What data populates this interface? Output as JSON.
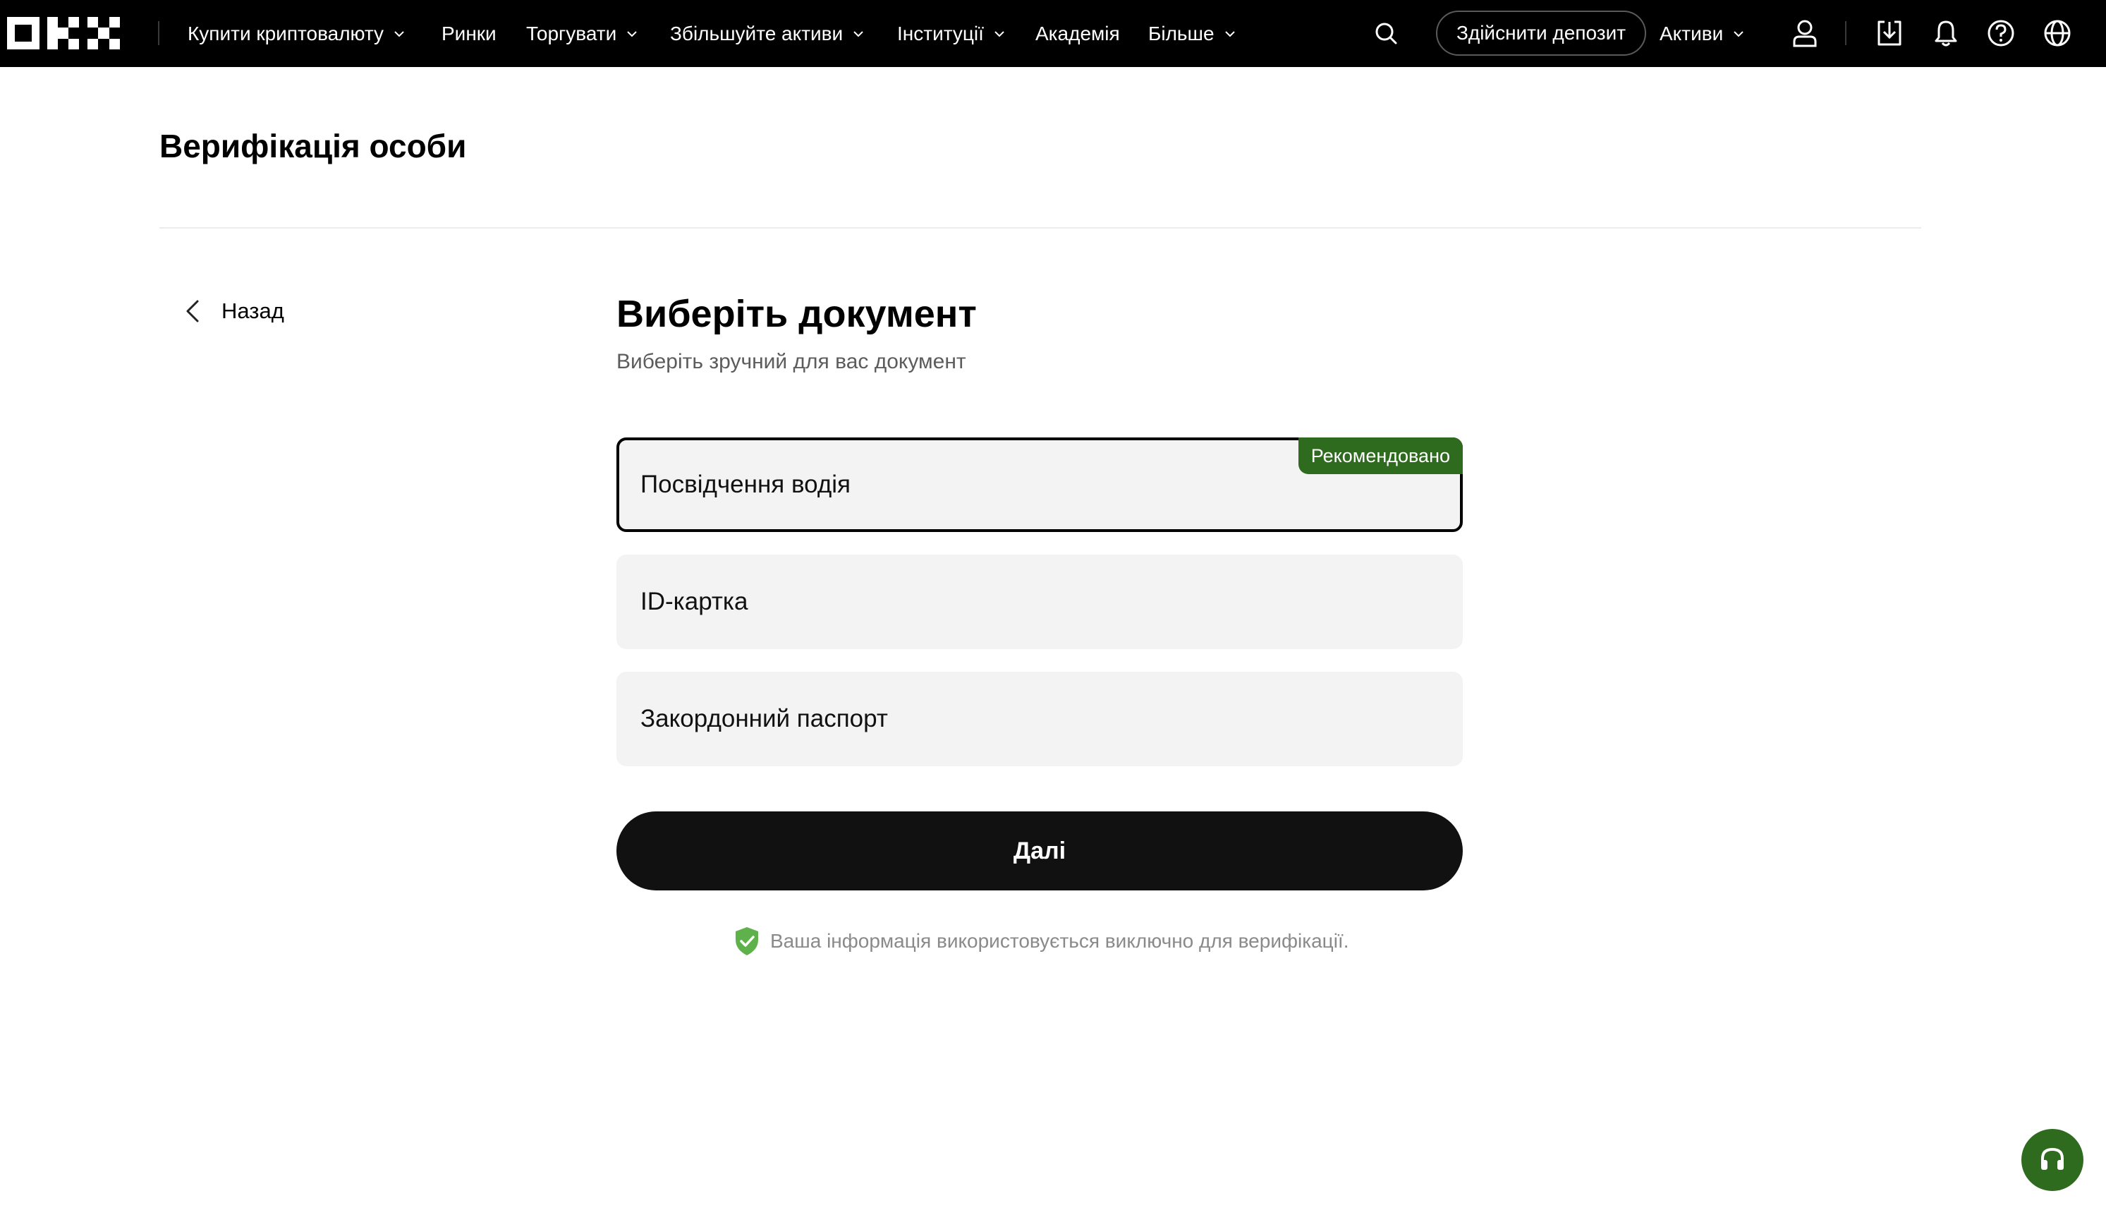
{
  "nav": {
    "items": [
      {
        "label": "Купити криптовалюту",
        "dropdown": true
      },
      {
        "label": "Ринки",
        "dropdown": false
      },
      {
        "label": "Торгувати",
        "dropdown": true
      },
      {
        "label": "Збільшуйте активи",
        "dropdown": true
      },
      {
        "label": "Інституції",
        "dropdown": true
      },
      {
        "label": "Академія",
        "dropdown": false
      },
      {
        "label": "Більше",
        "dropdown": true
      }
    ],
    "deposit_label": "Здійснити депозит",
    "assets_label": "Активи",
    "icons": [
      "search-icon",
      "user-icon",
      "download-icon",
      "bell-icon",
      "help-icon",
      "globe-icon"
    ]
  },
  "page": {
    "title": "Верифікація особи",
    "back_label": "Назад",
    "heading": "Виберіть документ",
    "subheading": "Виберіть зручний для вас документ",
    "options": [
      {
        "label": "Посвідчення водія",
        "selected": true,
        "badge": "Рекомендовано"
      },
      {
        "label": "ID-картка",
        "selected": false
      },
      {
        "label": "Закордонний паспорт",
        "selected": false
      }
    ],
    "next_label": "Далі",
    "privacy_note": "Ваша інформація використовується виключно для верифікації."
  },
  "colors": {
    "accent_green": "#2f6b1f",
    "shield_green": "#5fb24b",
    "topbar": "#000000",
    "option_bg": "#f3f3f3"
  }
}
